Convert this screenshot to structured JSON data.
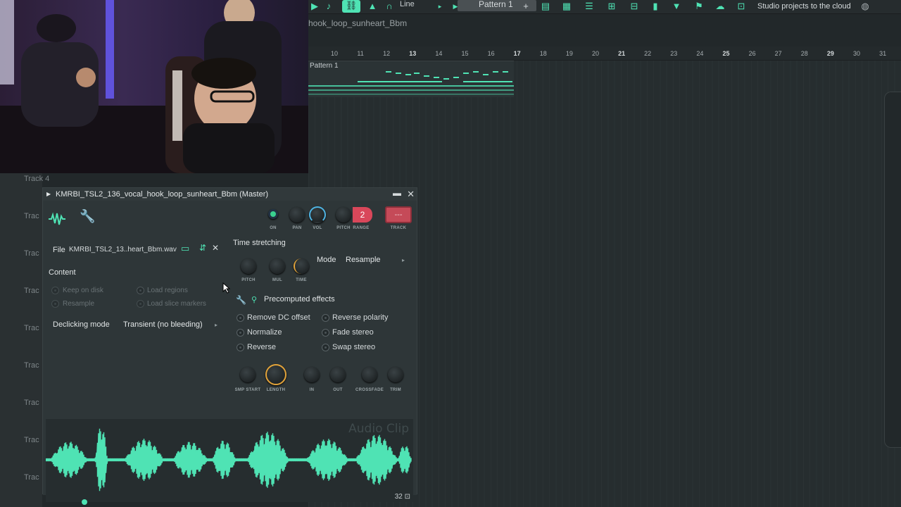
{
  "toolbar": {
    "snap_label": "Line",
    "pattern_label": "Pattern 1",
    "cloud_text": "Studio projects to the cloud",
    "icons": [
      "play-icon",
      "tempo-icon",
      "link-icon",
      "metronome-icon",
      "headphones-icon",
      "mixer-icon",
      "piano-roll-icon",
      "channel-rack-icon",
      "playlist-icon",
      "browser-icon",
      "plugin-icon",
      "funnel-icon",
      "cloud-icon",
      "shop-icon"
    ]
  },
  "breadcrumb": "hook_loop_sunheart_Bbm",
  "ruler": {
    "bars": [
      "10",
      "11",
      "12",
      "13",
      "14",
      "15",
      "16",
      "17",
      "18",
      "19",
      "20",
      "21",
      "22",
      "23",
      "24",
      "25",
      "26",
      "27",
      "28",
      "29",
      "30",
      "31"
    ],
    "major": [
      "13",
      "17",
      "21",
      "25",
      "29"
    ]
  },
  "playlist": {
    "pattern_clip_title": "Pattern 1",
    "tracks": [
      "Track 4",
      "Trac",
      "Trac",
      "Trac",
      "Trac",
      "Trac",
      "Trac",
      "Trac",
      "Trac",
      "Trac"
    ]
  },
  "channel_window": {
    "title": "KMRBI_TSL2_136_vocal_hook_loop_sunheart_Bbm (Master)",
    "header_knobs": {
      "on": "ON",
      "pan": "PAN",
      "vol": "VOL",
      "pitch": "PITCH",
      "range": "RANGE",
      "range_value": "2",
      "track": "TRACK",
      "track_value": "---"
    },
    "file": {
      "label": "File",
      "value": "KMRBI_TSL2_13..heart_Bbm.wav"
    },
    "content": {
      "title": "Content",
      "keep_on_disk": "Keep on disk",
      "resample": "Resample",
      "load_regions": "Load regions",
      "load_slice_markers": "Load slice markers"
    },
    "declicking": {
      "label": "Declicking mode",
      "value": "Transient (no bleeding)"
    },
    "time_stretching": {
      "title": "Time stretching",
      "pitch": "PITCH",
      "mul": "MUL",
      "time": "TIME",
      "mode_label": "Mode",
      "mode_value": "Resample"
    },
    "precomputed": {
      "title": "Precomputed effects",
      "remove_dc": "Remove DC offset",
      "normalize": "Normalize",
      "reverse": "Reverse",
      "reverse_polarity": "Reverse polarity",
      "fade_stereo": "Fade stereo",
      "swap_stereo": "Swap stereo"
    },
    "env_knobs": {
      "smp_start": "SMP START",
      "length": "LENGTH",
      "in": "IN",
      "out": "OUT",
      "crossfade": "CROSSFADE",
      "trim": "TRIM"
    },
    "waveform": {
      "watermark": "Audio Clip",
      "zoom": "32"
    }
  },
  "colors": {
    "accent": "#4fe3b4",
    "knob_ring": "#e2a33a",
    "vol_ring": "#4fb4e3",
    "track_btn": "#d9475a"
  }
}
